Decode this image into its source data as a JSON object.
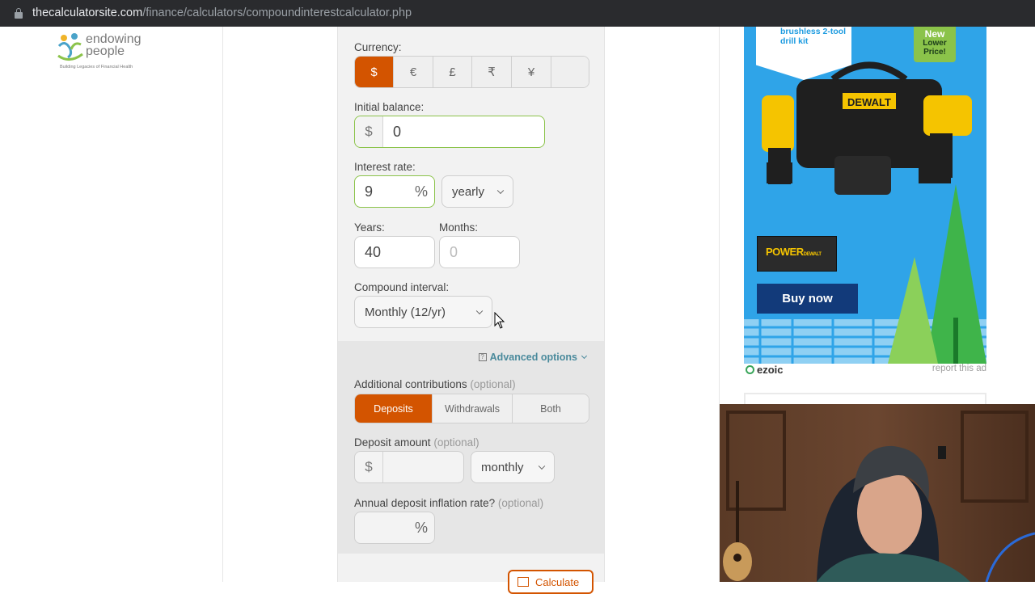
{
  "browser": {
    "url_domain": "thecalculatorsite.com",
    "url_path": "/finance/calculators/compoundinterestcalculator.php"
  },
  "logo": {
    "name_line1": "endowing",
    "name_line2": "people",
    "tagline": "Building Legacies of Financial Health"
  },
  "calculator": {
    "currency_label": "Currency:",
    "currencies": [
      "$",
      "€",
      "£",
      "₹",
      "¥",
      ""
    ],
    "currency_selected": "$",
    "initial_balance_label": "Initial balance:",
    "initial_balance_prefix": "$",
    "initial_balance_value": "0",
    "interest_rate_label": "Interest rate:",
    "interest_rate_value": "9",
    "interest_rate_suffix": "%",
    "interest_period": "yearly",
    "years_label": "Years:",
    "years_value": "40",
    "months_label": "Months:",
    "months_placeholder": "0",
    "compound_label": "Compound interval:",
    "compound_value": "Monthly (12/yr)",
    "advanced_link": "Advanced options",
    "contrib_label": "Additional contributions",
    "optional": "(optional)",
    "contrib_tabs": [
      "Deposits",
      "Withdrawals",
      "Both"
    ],
    "contrib_selected": "Deposits",
    "deposit_label": "Deposit amount",
    "deposit_prefix": "$",
    "deposit_period": "monthly",
    "inflation_label": "Annual deposit inflation rate?",
    "inflation_suffix": "%",
    "calculate_label": "Calculate"
  },
  "ad": {
    "tag_line1": "brushless 2-tool",
    "tag_line2": "drill kit",
    "new_line1": "New",
    "new_line2": "Lower",
    "new_line3": "Price!",
    "brand": "DEWALT",
    "power_text": "POWER DEWALT POSSIBILITIES",
    "cta": "Buy now",
    "network": "ezoic",
    "report": "report this ad"
  },
  "colors": {
    "accent": "#d35400",
    "valid_border": "#8bc34a",
    "link": "#4a8a9c",
    "ad_bg": "#2fa4e8"
  }
}
